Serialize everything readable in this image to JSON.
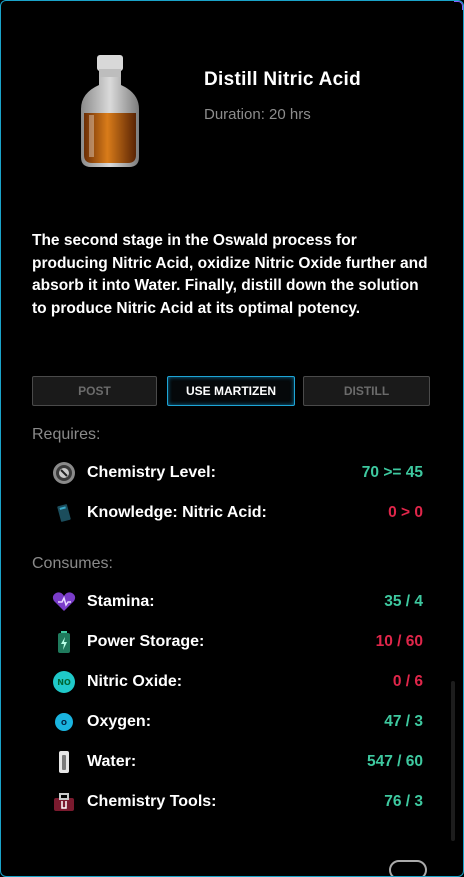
{
  "recipe": {
    "title": "Distill Nitric Acid",
    "duration": "Duration: 20 hrs",
    "description": "The second stage in the Oswald process for producing Nitric Acid, oxidize Nitric Oxide further and absorb it into Water. Finally, distill down the solution to produce Nitric Acid at its optimal potency."
  },
  "actions": {
    "post": "POST",
    "use_martizen": "USE MARTIZEN",
    "distill": "DISTILL"
  },
  "requires": {
    "heading": "Requires:",
    "items": [
      {
        "icon": "chemistry-level-icon",
        "label": "Chemistry Level:",
        "value": "70 >= 45",
        "status": "ok"
      },
      {
        "icon": "knowledge-book-icon",
        "label": "Knowledge: Nitric Acid:",
        "value": "0 > 0",
        "status": "fail"
      }
    ]
  },
  "consumes": {
    "heading": "Consumes:",
    "items": [
      {
        "icon": "stamina-heart-icon",
        "label": "Stamina:",
        "value": "35 / 4",
        "status": "ok"
      },
      {
        "icon": "battery-icon",
        "label": "Power Storage:",
        "value": "10 / 60",
        "status": "fail"
      },
      {
        "icon": "nitric-oxide-icon",
        "label": "Nitric Oxide:",
        "value": "0 / 6",
        "status": "fail"
      },
      {
        "icon": "oxygen-icon",
        "label": "Oxygen:",
        "value": "47 / 3",
        "status": "ok"
      },
      {
        "icon": "water-icon",
        "label": "Water:",
        "value": "547 / 60",
        "status": "ok"
      },
      {
        "icon": "chemistry-tools-icon",
        "label": "Chemistry Tools:",
        "value": "76 / 3",
        "status": "ok"
      }
    ]
  },
  "colors": {
    "ok": "#3ec9a0",
    "fail": "#e0264a",
    "accent": "#1ea5d6"
  }
}
